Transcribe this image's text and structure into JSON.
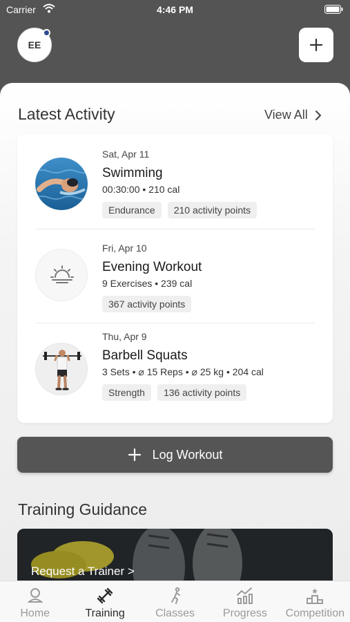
{
  "status_bar": {
    "carrier": "Carrier",
    "time": "4:46 PM"
  },
  "header": {
    "avatar_initials": "EE",
    "add_icon": "plus-icon"
  },
  "latest_activity": {
    "title": "Latest Activity",
    "view_all_label": "View All",
    "items": [
      {
        "date": "Sat, Apr 11",
        "name": "Swimming",
        "meta": "00:30:00 • 210 cal",
        "tags": [
          "Endurance",
          "210 activity points"
        ],
        "thumbnail": "swimmer-photo"
      },
      {
        "date": "Fri, Apr 10",
        "name": "Evening Workout",
        "meta": "9 Exercises • 239 cal",
        "tags": [
          "367 activity points"
        ],
        "thumbnail": "sunset-icon"
      },
      {
        "date": "Thu, Apr 9",
        "name": "Barbell Squats",
        "meta": "3 Sets • ⌀ 15 Reps • ⌀ 25 kg • 204 cal",
        "tags": [
          "Strength",
          "136 activity points"
        ],
        "thumbnail": "barbell-photo"
      }
    ]
  },
  "log_workout": {
    "label": "Log Workout"
  },
  "training_guidance": {
    "title": "Training Guidance",
    "request_link": "Request a Trainer >"
  },
  "tabs": [
    {
      "label": "Home",
      "icon": "home-icon",
      "active": false
    },
    {
      "label": "Training",
      "icon": "dumbbell-icon",
      "active": true
    },
    {
      "label": "Classes",
      "icon": "classes-icon",
      "active": false
    },
    {
      "label": "Progress",
      "icon": "progress-chart-icon",
      "active": false
    },
    {
      "label": "Competition",
      "icon": "podium-icon",
      "active": false
    }
  ],
  "colors": {
    "header_bg": "#545454",
    "accent_dot": "#2e4a8e",
    "button_bg": "#555555"
  }
}
